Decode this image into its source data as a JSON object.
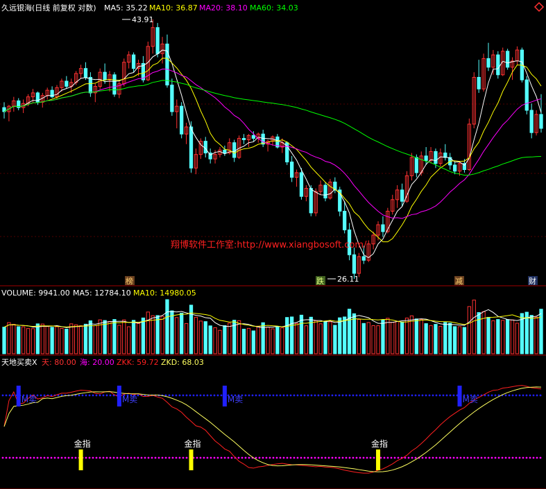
{
  "header": {
    "title": "久远银海(日线 前复权 对数)",
    "ma5_label": "MA5: 35.22",
    "ma10_label": "MA10: 36.87",
    "ma20_label": "MA20: 38.10",
    "ma60_label": "MA60: 34.03",
    "corner_icon": "diamond-icon"
  },
  "price_panel": {
    "high_label": "43.91",
    "low_label": "26.11",
    "watermark": "翔博软件工作室:http://www.xiangbosoft.com/",
    "event_tags": [
      {
        "text": "榜",
        "color": "#b08040"
      },
      {
        "text": "跌",
        "color": "#c0d060"
      },
      {
        "text": "减",
        "color": "#b08040"
      },
      {
        "text": "财",
        "color": "#ffffff"
      }
    ]
  },
  "volume_panel": {
    "volume_label": "VOLUME: 9941.00",
    "ma5_label": "MA5: 12784.10",
    "ma10_label": "MA10: 14980.05"
  },
  "indicator_panel": {
    "name": "天地买卖X",
    "tian_label": "天: 80.00",
    "hai_label": "海: 20.00",
    "zkk_label": "ZKK: 59.72",
    "zkd_label": "ZKD: 68.03",
    "signal_texts": {
      "gold": "金指",
      "buy": "M买",
      "sell": "M卖",
      "sell_green": "M卖",
      "topsell": "M卖"
    }
  },
  "colors": {
    "background": "#000000",
    "up_candle": "#ff3232",
    "down_candle": "#54ffff",
    "ma5": "#ffffff",
    "ma10": "#ffff00",
    "ma20": "#ff00ff",
    "ma60": "#00ff00",
    "grid": "#a00000",
    "zkk": "#ff2020",
    "zkd": "#ffff60",
    "dots_top": "#2020ff",
    "dots_bottom": "#ff00ff"
  },
  "chart_data": {
    "type": "candlestick",
    "scale": "log",
    "price_range": [
      26.11,
      43.91
    ],
    "candles_ohlc": [
      [
        36.8,
        37.2,
        36.0,
        36.5
      ],
      [
        36.5,
        37.0,
        35.8,
        36.9
      ],
      [
        36.9,
        37.6,
        36.5,
        37.3
      ],
      [
        37.3,
        37.5,
        36.6,
        36.8
      ],
      [
        36.8,
        37.4,
        36.4,
        37.1
      ],
      [
        37.1,
        37.8,
        36.9,
        37.6
      ],
      [
        37.6,
        38.2,
        37.2,
        37.9
      ],
      [
        37.9,
        38.0,
        37.0,
        37.2
      ],
      [
        37.2,
        37.9,
        36.8,
        37.7
      ],
      [
        37.7,
        38.3,
        37.4,
        38.1
      ],
      [
        38.1,
        38.4,
        37.5,
        37.6
      ],
      [
        37.6,
        38.5,
        37.4,
        38.3
      ],
      [
        38.3,
        39.0,
        38.0,
        38.8
      ],
      [
        38.8,
        39.2,
        38.2,
        38.4
      ],
      [
        38.4,
        39.0,
        37.9,
        38.7
      ],
      [
        38.7,
        39.6,
        38.5,
        39.4
      ],
      [
        39.4,
        40.1,
        39.0,
        39.8
      ],
      [
        39.8,
        40.3,
        38.9,
        39.1
      ],
      [
        39.1,
        39.5,
        37.6,
        37.9
      ],
      [
        37.9,
        38.6,
        37.2,
        38.4
      ],
      [
        38.4,
        39.8,
        38.2,
        39.5
      ],
      [
        39.5,
        40.2,
        38.6,
        38.9
      ],
      [
        38.9,
        39.6,
        38.0,
        39.3
      ],
      [
        39.3,
        39.5,
        37.6,
        37.8
      ],
      [
        37.8,
        38.8,
        37.5,
        38.6
      ],
      [
        38.6,
        40.6,
        38.4,
        40.3
      ],
      [
        40.3,
        41.2,
        39.8,
        40.9
      ],
      [
        40.9,
        41.1,
        39.5,
        39.8
      ],
      [
        39.8,
        40.5,
        39.2,
        40.2
      ],
      [
        40.2,
        40.8,
        38.7,
        38.9
      ],
      [
        38.9,
        42.0,
        38.8,
        41.6
      ],
      [
        41.6,
        43.91,
        41.0,
        43.2
      ],
      [
        43.2,
        43.6,
        40.7,
        41.0
      ],
      [
        41.0,
        42.4,
        40.2,
        41.8
      ],
      [
        41.8,
        42.6,
        38.3,
        38.5
      ],
      [
        38.5,
        39.0,
        36.2,
        36.5
      ],
      [
        36.5,
        37.4,
        35.3,
        36.9
      ],
      [
        36.9,
        37.2,
        34.6,
        34.9
      ],
      [
        34.9,
        35.7,
        34.2,
        35.4
      ],
      [
        35.4,
        35.8,
        32.3,
        32.6
      ],
      [
        32.6,
        33.9,
        32.2,
        33.5
      ],
      [
        33.5,
        34.6,
        33.2,
        34.4
      ],
      [
        34.4,
        34.7,
        33.3,
        33.6
      ],
      [
        33.6,
        33.9,
        32.9,
        33.2
      ],
      [
        33.2,
        33.8,
        32.9,
        33.5
      ],
      [
        33.5,
        34.0,
        33.3,
        33.8
      ],
      [
        33.8,
        34.1,
        33.4,
        33.6
      ],
      [
        33.6,
        34.6,
        33.5,
        34.3
      ],
      [
        34.3,
        34.5,
        33.0,
        33.3
      ],
      [
        33.3,
        34.8,
        33.2,
        34.6
      ],
      [
        34.6,
        34.9,
        34.2,
        34.5
      ],
      [
        34.5,
        34.9,
        34.0,
        34.8
      ],
      [
        34.8,
        35.1,
        34.4,
        34.6
      ],
      [
        34.6,
        35.0,
        34.3,
        34.9
      ],
      [
        34.9,
        35.2,
        34.0,
        34.2
      ],
      [
        34.2,
        34.5,
        33.7,
        34.4
      ],
      [
        34.4,
        34.8,
        34.1,
        34.7
      ],
      [
        34.7,
        34.9,
        33.9,
        34.0
      ],
      [
        34.0,
        34.6,
        33.6,
        34.3
      ],
      [
        34.3,
        34.4,
        32.8,
        33.0
      ],
      [
        33.0,
        33.4,
        31.7,
        32.0
      ],
      [
        32.0,
        32.5,
        31.4,
        32.3
      ],
      [
        32.3,
        32.6,
        30.6,
        30.8
      ],
      [
        30.8,
        31.5,
        30.5,
        31.3
      ],
      [
        31.3,
        31.5,
        29.6,
        29.8
      ],
      [
        29.8,
        31.3,
        29.6,
        31.1
      ],
      [
        31.1,
        31.8,
        30.9,
        31.5
      ],
      [
        31.5,
        31.7,
        30.5,
        30.7
      ],
      [
        30.7,
        31.9,
        30.6,
        31.7
      ],
      [
        31.7,
        32.0,
        31.0,
        31.2
      ],
      [
        31.2,
        31.4,
        29.6,
        29.9
      ],
      [
        29.9,
        30.5,
        28.6,
        28.8
      ],
      [
        28.8,
        29.2,
        27.1,
        27.4
      ],
      [
        27.4,
        27.8,
        26.11,
        26.4
      ],
      [
        26.4,
        27.5,
        26.2,
        27.3
      ],
      [
        27.3,
        27.9,
        26.9,
        27.1
      ],
      [
        27.1,
        28.2,
        27.0,
        28.0
      ],
      [
        28.0,
        28.7,
        27.7,
        28.5
      ],
      [
        28.5,
        29.3,
        28.2,
        29.1
      ],
      [
        29.1,
        29.6,
        28.4,
        28.7
      ],
      [
        28.7,
        30.1,
        28.6,
        29.9
      ],
      [
        29.9,
        30.9,
        29.7,
        30.6
      ],
      [
        30.6,
        31.5,
        30.1,
        31.2
      ],
      [
        31.2,
        31.6,
        30.2,
        30.5
      ],
      [
        30.5,
        32.4,
        30.4,
        32.1
      ],
      [
        32.1,
        33.6,
        31.8,
        33.3
      ],
      [
        33.3,
        33.5,
        32.0,
        32.3
      ],
      [
        32.3,
        33.7,
        32.1,
        33.4
      ],
      [
        33.4,
        34.0,
        32.8,
        33.1
      ],
      [
        33.1,
        34.0,
        32.9,
        33.7
      ],
      [
        33.7,
        33.9,
        32.6,
        32.9
      ],
      [
        32.9,
        33.9,
        32.7,
        33.6
      ],
      [
        33.6,
        34.2,
        33.1,
        33.3
      ],
      [
        33.3,
        33.6,
        32.5,
        32.8
      ],
      [
        32.8,
        33.0,
        32.2,
        32.4
      ],
      [
        32.4,
        33.0,
        32.1,
        32.9
      ],
      [
        32.9,
        33.2,
        32.3,
        32.5
      ],
      [
        32.5,
        36.0,
        32.4,
        35.6
      ],
      [
        35.6,
        39.5,
        35.3,
        39.1
      ],
      [
        39.1,
        40.5,
        37.9,
        38.2
      ],
      [
        38.2,
        41.0,
        38.0,
        40.6
      ],
      [
        40.6,
        41.9,
        39.6,
        39.9
      ],
      [
        39.9,
        41.3,
        39.3,
        40.9
      ],
      [
        40.9,
        41.2,
        39.0,
        39.3
      ],
      [
        39.3,
        41.5,
        39.2,
        41.2
      ],
      [
        41.2,
        41.4,
        39.7,
        39.9
      ],
      [
        39.9,
        40.7,
        38.9,
        40.4
      ],
      [
        40.4,
        41.6,
        40.1,
        41.3
      ],
      [
        41.3,
        41.5,
        38.7,
        38.9
      ],
      [
        38.9,
        39.2,
        36.3,
        36.6
      ],
      [
        36.6,
        37.1,
        34.6,
        35.0
      ],
      [
        35.0,
        36.6,
        34.8,
        36.3
      ],
      [
        36.3,
        37.8,
        35.0,
        35.3
      ]
    ],
    "ma_lines": [
      "MA5",
      "MA10",
      "MA20",
      "MA60"
    ],
    "volume_ma": [
      "MA5",
      "MA10"
    ],
    "indicator_lines": [
      "ZKK",
      "ZKD"
    ],
    "indicator_levels": {
      "tian": 80,
      "hai": 20,
      "zkk_last": 59.72,
      "zkd_last": 68.03
    },
    "gold_signal_bars": [
      16,
      39,
      78,
      124,
      133,
      145,
      165
    ],
    "sell_signal_bars": [
      3,
      24,
      46,
      95,
      115,
      156,
      175
    ],
    "buy_signal_bars": [
      119,
      138
    ]
  }
}
